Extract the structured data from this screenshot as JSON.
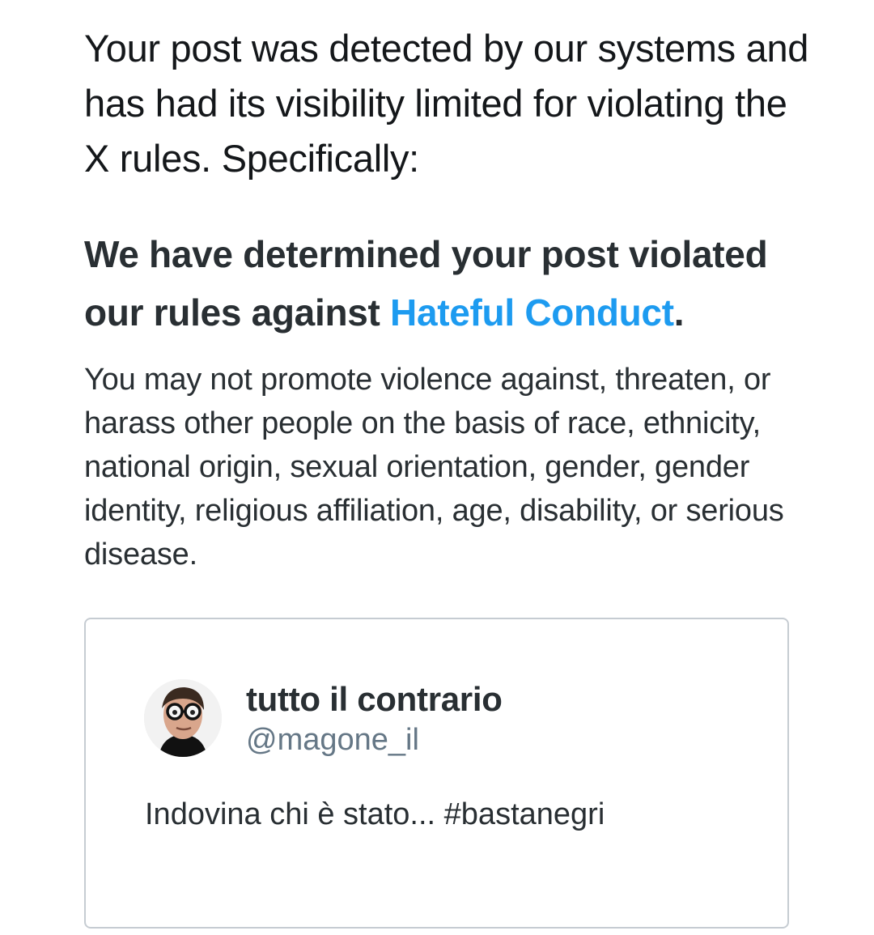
{
  "notice": {
    "intro_text": "Your post was detected by our systems and has had its visibility limited for violating the X rules. Specifically:",
    "heading_prefix": "We have determined your post violated our rules against ",
    "heading_link": "Hateful Conduct",
    "heading_suffix": ".",
    "rule_description": "You may not promote violence against, threaten, or harass other people on the basis of race, ethnicity, national origin, sexual orientation, gender, gender identity, religious affiliation, age, disability, or serious disease."
  },
  "tweet": {
    "display_name": "tutto il contrario",
    "handle": "@magone_il",
    "text": "Indovina chi è stato... #bastanegri"
  },
  "colors": {
    "link": "#1d9bf0",
    "text_primary": "#292f33",
    "text_secondary": "#657786",
    "card_border": "#c6ccd2"
  }
}
